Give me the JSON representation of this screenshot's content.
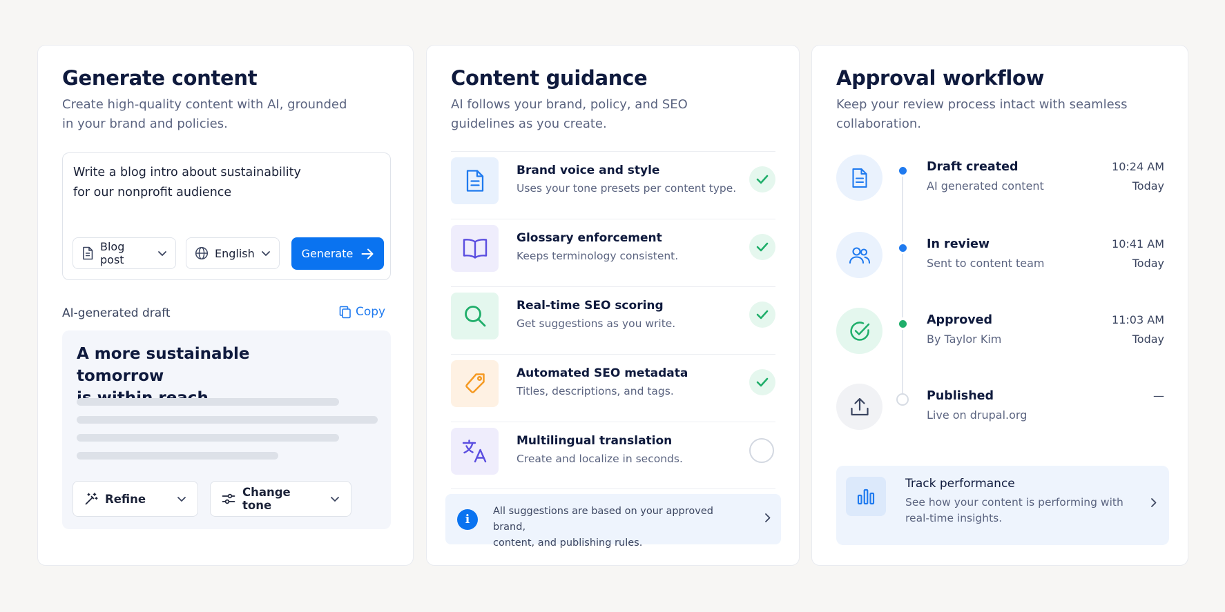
{
  "generate": {
    "title": "Generate content",
    "subtitle": "Create high-quality content with AI, grounded in your brand and policies.",
    "prompt_line1": "Write a blog intro about sustainability",
    "prompt_line2": "for our nonprofit audience",
    "content_type": "Blog post",
    "language": "English",
    "generate_label": "Generate",
    "draft_label": "AI-generated draft",
    "copy_label": "Copy",
    "draft_line1": "A more sustainable tomorrow",
    "draft_line2": "is within reach.",
    "refine_label": "Refine",
    "change_tone_label": "Change tone"
  },
  "guidance": {
    "title": "Content guidance",
    "subtitle": "AI follows your brand, policy, and SEO guidelines as you create.",
    "items": [
      {
        "title": "Brand voice and style",
        "desc": "Uses your tone presets per content type.",
        "icon": "document-icon",
        "checked": true
      },
      {
        "title": "Glossary enforcement",
        "desc": "Keeps terminology consistent.",
        "icon": "book-icon",
        "checked": true
      },
      {
        "title": "Real-time SEO scoring",
        "desc": "Get suggestions as you write.",
        "icon": "search-icon",
        "checked": true
      },
      {
        "title": "Automated SEO metadata",
        "desc": "Titles, descriptions, and tags.",
        "icon": "tag-icon",
        "checked": true
      },
      {
        "title": "Multilingual translation",
        "desc": "Create and localize in seconds.",
        "icon": "translate-icon",
        "checked": false
      }
    ],
    "info_line1": "All suggestions are based on your approved brand,",
    "info_line2": "content, and publishing rules."
  },
  "workflow": {
    "title": "Approval workflow",
    "subtitle": "Keep your review process intact with seamless collaboration.",
    "steps": [
      {
        "title": "Draft created",
        "sub": "AI generated content",
        "time": "10:24 AM",
        "day": "Today",
        "icon": "document-icon",
        "status": "done"
      },
      {
        "title": "In review",
        "sub": "Sent to content team",
        "time": "10:41 AM",
        "day": "Today",
        "icon": "users-icon",
        "status": "done"
      },
      {
        "title": "Approved",
        "sub": "By Taylor Kim",
        "time": "11:03 AM",
        "day": "Today",
        "icon": "check-circle-icon",
        "status": "approved"
      },
      {
        "title": "Published",
        "sub": "Live on drupal.org",
        "time": "—",
        "day": "",
        "icon": "upload-icon",
        "status": "pending"
      }
    ],
    "track_title": "Track performance",
    "track_desc": "See how your content is performing with real-time insights."
  },
  "colors": {
    "accent": "#0a73f0",
    "success": "#1fae6a",
    "orange": "#f59a23",
    "purple": "#5b4ee0",
    "background": "#f7f6f4"
  }
}
